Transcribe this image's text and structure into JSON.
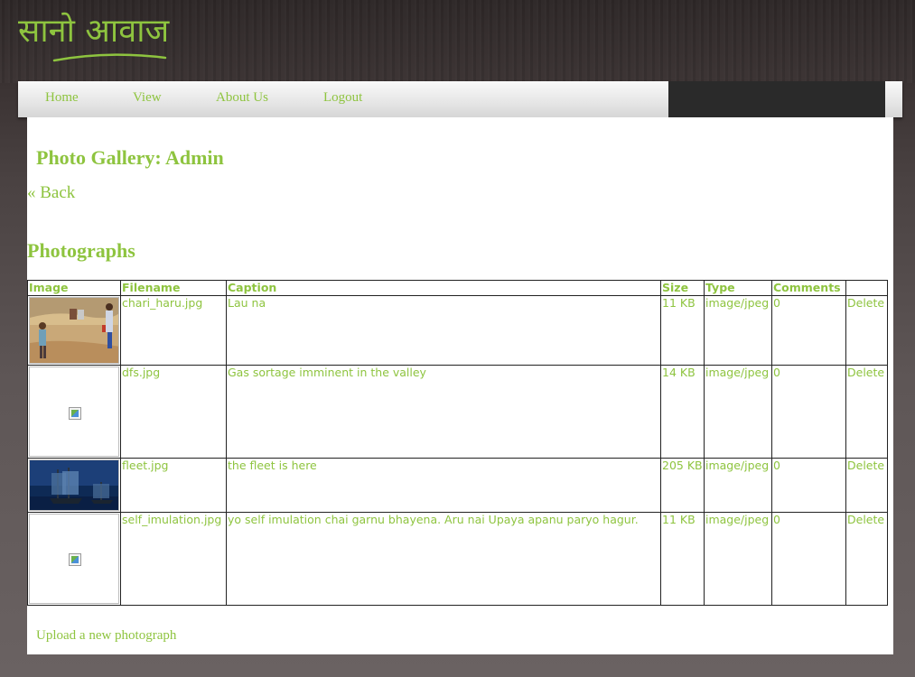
{
  "site": {
    "logo_text": "सानो आवाज"
  },
  "nav": {
    "items": [
      "Home",
      "View",
      "About Us",
      "Logout"
    ]
  },
  "page": {
    "title": "Photo Gallery: Admin",
    "back_link": "« Back",
    "section_title": "Photographs",
    "upload_link": "Upload a new photograph"
  },
  "table": {
    "headers": [
      "Image",
      "Filename",
      "Caption",
      "Size",
      "Type",
      "Comments",
      ""
    ],
    "rows": [
      {
        "image": "photo-children-hillside",
        "filename": "chari_haru.jpg",
        "caption": "Lau na",
        "size": "11 KB",
        "type": "image/jpeg",
        "comments": "0",
        "action": "Delete"
      },
      {
        "image": "broken-image-icon",
        "filename": "dfs.jpg",
        "caption": "Gas sortage imminent in the valley",
        "size": "14 KB",
        "type": "image/jpeg",
        "comments": "0",
        "action": "Delete"
      },
      {
        "image": "photo-ships-at-sea",
        "filename": "fleet.jpg",
        "caption": "the fleet is here",
        "size": "205 KB",
        "type": "image/jpeg",
        "comments": "0",
        "action": "Delete"
      },
      {
        "image": "broken-image-icon",
        "filename": "self_imulation.jpg",
        "caption": "yo self imulation chai garnu bhayena. Aru nai Upaya apanu paryo hagur.",
        "size": "11 KB",
        "type": "image/jpeg",
        "comments": "0",
        "action": "Delete"
      }
    ]
  },
  "colors": {
    "accent": "#8ec43f",
    "nav_dark": "#2a2a2a",
    "background_dark": "#2d2727"
  }
}
